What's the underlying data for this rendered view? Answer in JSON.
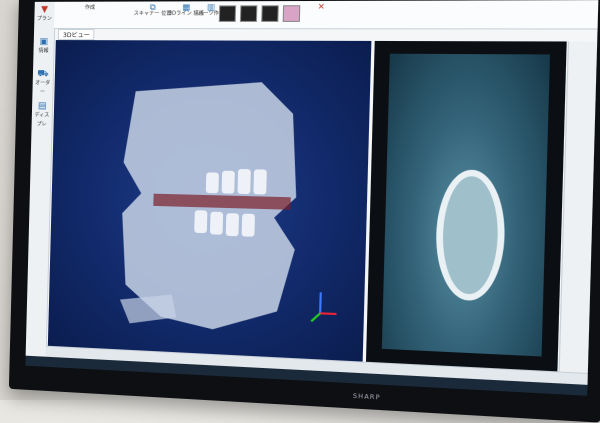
{
  "sidebar": {
    "items": [
      "プラン",
      "情報",
      "オーダー",
      "ディスプレ"
    ]
  },
  "ribbon": {
    "items": [
      "作成",
      "スキャナー 位置",
      "3Dライン 描画",
      "パーツ作成"
    ]
  },
  "main": {
    "view_tab": "3Dビュー"
  },
  "tv": {
    "brand": "SHARP"
  },
  "colors": {
    "volume_bg": "#122a6b",
    "slice_bg": "#0b0f14",
    "accent": "#2a6fb0"
  }
}
